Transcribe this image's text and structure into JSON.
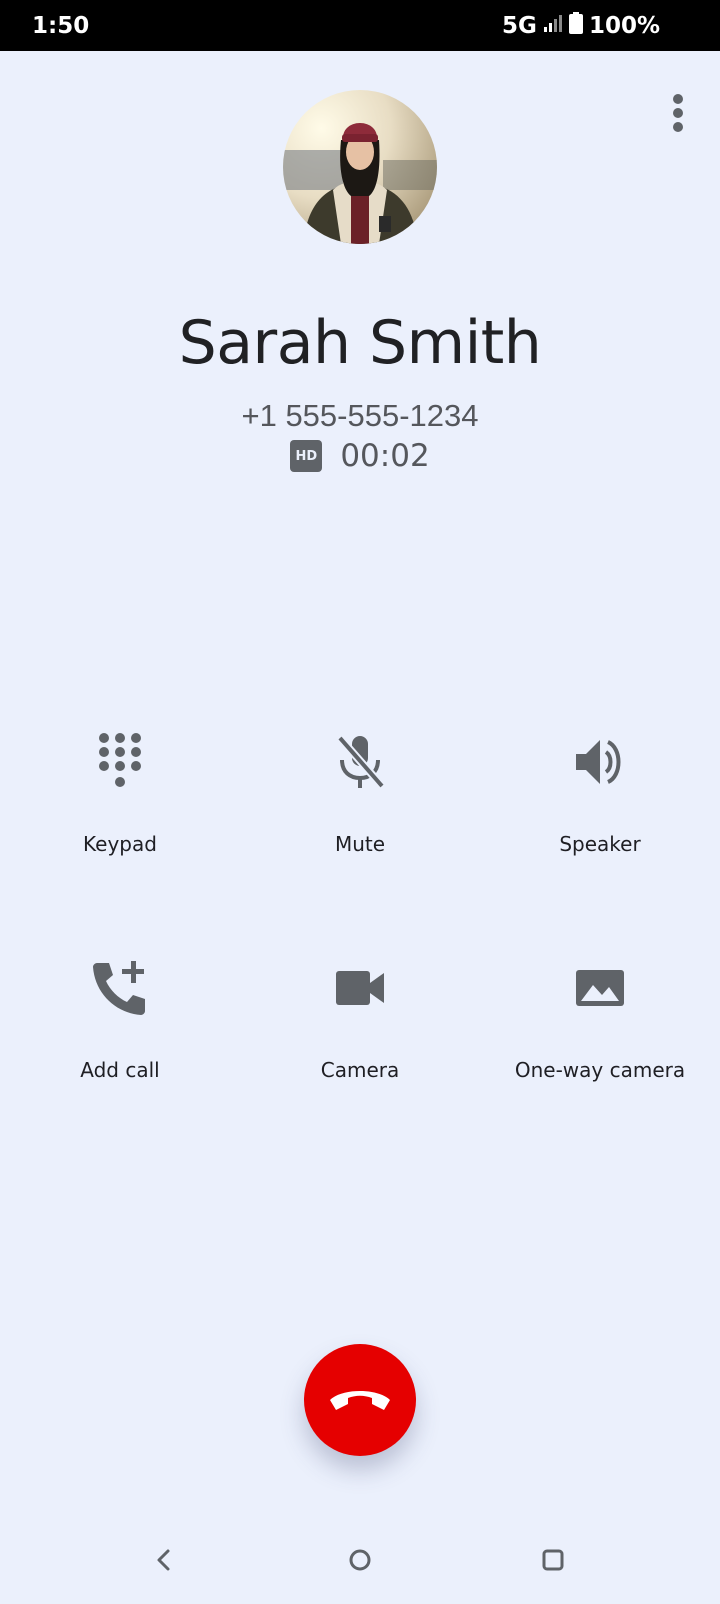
{
  "status_bar": {
    "time": "1:50",
    "network": "5G",
    "battery": "100%"
  },
  "caller": {
    "name": "Sarah Smith",
    "number": "+1 555-555-1234",
    "hd_label": "HD",
    "duration": "00:02"
  },
  "controls": {
    "keypad": "Keypad",
    "mute": "Mute",
    "speaker": "Speaker",
    "add_call": "Add call",
    "camera": "Camera",
    "one_way_camera": "One-way camera"
  },
  "colors": {
    "background": "#ebf0fc",
    "icon": "#5f6368",
    "end_call": "#e50000"
  },
  "icons": {
    "overflow": "more-vert-icon",
    "keypad": "dialpad-icon",
    "mute": "mic-off-icon",
    "speaker": "volume-up-icon",
    "add_call": "add-call-icon",
    "camera": "videocam-icon",
    "one_way_camera": "landscape-photo-icon",
    "end_call": "call-end-icon"
  }
}
